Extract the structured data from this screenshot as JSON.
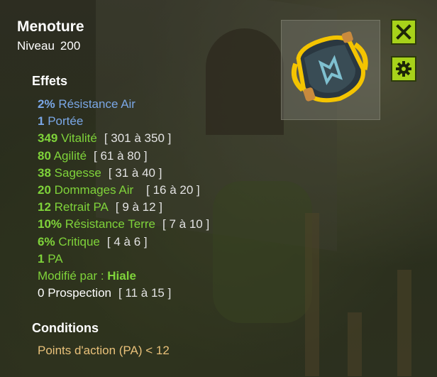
{
  "item": {
    "name": "Menoture",
    "level_label": "Niveau",
    "level_value": "200",
    "icon": "armor-breastplate-icon"
  },
  "effects": {
    "heading": "Effets",
    "lines": [
      {
        "value": "2%",
        "label": "Résistance Air",
        "range": "",
        "color": "#7aa7e6"
      },
      {
        "value": "1",
        "label": "Portée",
        "range": "",
        "color": "#7aa7e6"
      },
      {
        "value": "349",
        "label": "Vitalité",
        "range": "[ 301 à 350 ]",
        "color": "#7fd33a"
      },
      {
        "value": "80",
        "label": "Agilité",
        "range": "[ 61 à 80 ]",
        "color": "#7fd33a"
      },
      {
        "value": "38",
        "label": "Sagesse",
        "range": "[ 31 à 40 ]",
        "color": "#7fd33a"
      },
      {
        "value": "20",
        "label": "Dommages Air",
        "range": "[ 16 à 20 ]",
        "color": "#7fd33a"
      },
      {
        "value": "12",
        "label": "Retrait PA",
        "range": "[ 9 à 12 ]",
        "color": "#7fd33a"
      },
      {
        "value": "10%",
        "label": "Résistance Terre",
        "range": "[ 7 à 10 ]",
        "color": "#7fd33a"
      },
      {
        "value": "6%",
        "label": "Critique",
        "range": "[ 4 à 6 ]",
        "color": "#7fd33a"
      },
      {
        "value": "1",
        "label": "PA",
        "range": "",
        "color": "#7fd33a"
      }
    ],
    "modified_label": "Modifié par :",
    "modified_by": "Hiale",
    "prospection": {
      "value": "0",
      "label": "Prospection",
      "range": "[ 11 à 15 ]"
    }
  },
  "conditions": {
    "heading": "Conditions",
    "text": "Points d'action (PA) < 12"
  },
  "buttons": {
    "close_icon": "close-icon",
    "settings_icon": "gear-icon"
  },
  "colors": {
    "button_green": "#a7d21a",
    "effect_blue": "#7aa7e6",
    "effect_green": "#7fd33a",
    "condition_text": "#e9c17a"
  }
}
